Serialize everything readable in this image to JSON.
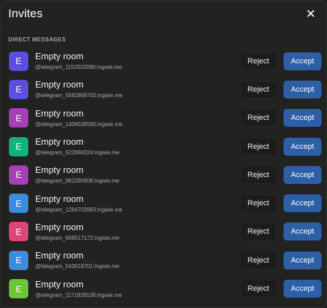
{
  "dialog": {
    "title": "Invites",
    "close_icon": "close-icon",
    "section_label": "DIRECT MESSAGES"
  },
  "colors": {
    "accept": "#2d5fa7",
    "reject_bg": "#1c1c1b",
    "background": "#222221"
  },
  "invites": [
    {
      "initial": "E",
      "name": "Empty room",
      "id": "@telegram_1152503080:ingwie.me",
      "color": "#5b4ee0",
      "reject": "Reject",
      "accept": "Accept"
    },
    {
      "initial": "E",
      "name": "Empty room",
      "id": "@telegram_5592869700:ingwie.me",
      "color": "#5b4ee0",
      "reject": "Reject",
      "accept": "Accept"
    },
    {
      "initial": "E",
      "name": "Empty room",
      "id": "@telegram_1409536590:ingwie.me",
      "color": "#a541b5",
      "reject": "Reject",
      "accept": "Accept"
    },
    {
      "initial": "E",
      "name": "Empty room",
      "id": "@telegram_922860024:ingwie.me",
      "color": "#12b27c",
      "reject": "Reject",
      "accept": "Accept"
    },
    {
      "initial": "E",
      "name": "Empty room",
      "id": "@telegram_982390908:ingwie.me",
      "color": "#a541b5",
      "reject": "Reject",
      "accept": "Accept"
    },
    {
      "initial": "E",
      "name": "Empty room",
      "id": "@telegram_1284703983:ingwie.me",
      "color": "#3d8bde",
      "reject": "Reject",
      "accept": "Accept"
    },
    {
      "initial": "E",
      "name": "Empty room",
      "id": "@telegram_609517172:ingwie.me",
      "color": "#e0457a",
      "reject": "Reject",
      "accept": "Accept"
    },
    {
      "initial": "E",
      "name": "Empty room",
      "id": "@telegram_543919701:ingwie.me",
      "color": "#3d8bde",
      "reject": "Reject",
      "accept": "Accept"
    },
    {
      "initial": "E",
      "name": "Empty room",
      "id": "@telegram_1171828109:ingwie.me",
      "color": "#6cc635",
      "reject": "Reject",
      "accept": "Accept"
    }
  ]
}
